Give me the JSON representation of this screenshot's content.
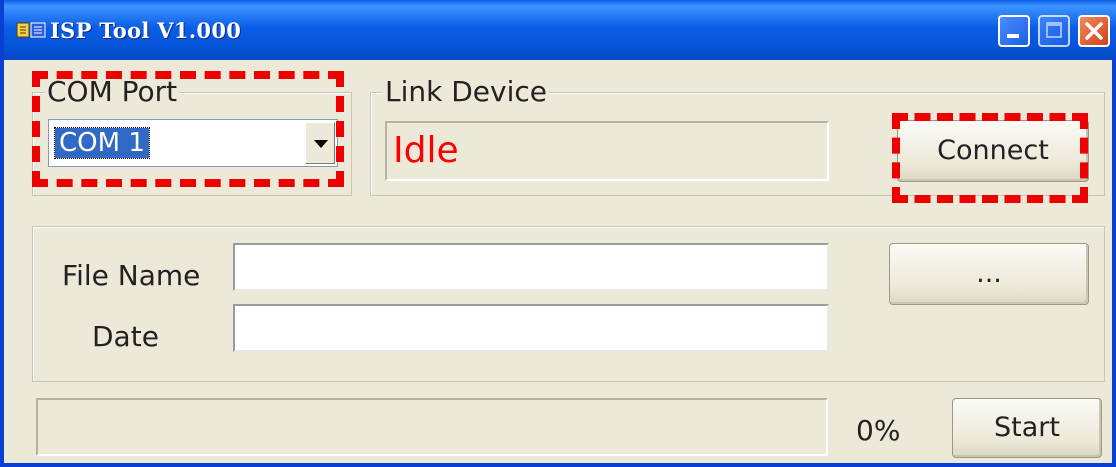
{
  "window": {
    "title": "ISP Tool V1.000",
    "app_icon": "chip-icon",
    "controls": [
      "minimize-icon",
      "maximize-icon",
      "close-icon"
    ]
  },
  "com_port": {
    "legend": "COM Port",
    "selected": "COM 1"
  },
  "link_device": {
    "legend": "Link Device",
    "status": "Idle",
    "status_color": "#ff0000",
    "connect_label": "Connect"
  },
  "file": {
    "name_label": "File Name",
    "name_value": "",
    "date_label": "Date",
    "date_value": "",
    "browse_label": "..."
  },
  "progress": {
    "value": 0,
    "percent_text": "0%"
  },
  "actions": {
    "start_label": "Start"
  },
  "annotations": {
    "highlight_color": "#ee0000"
  }
}
